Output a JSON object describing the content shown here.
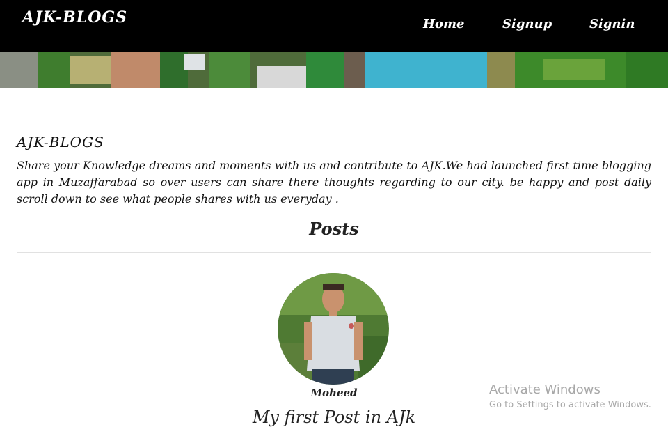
{
  "navbar": {
    "brand": "AJK-BLOGS",
    "links": [
      "Home",
      "Signup",
      "Signin"
    ]
  },
  "intro": {
    "title": "AJK-BLOGS",
    "text": "Share your Knowledge dreams and moments with us and contribute to AJK.We had launched first time blogging app in Muzaffarabad so over users can share there thoughts regarding to our city. be happy and post daily scroll down to see what people shares with us everyday ."
  },
  "posts": {
    "heading": "Posts",
    "items": [
      {
        "author": "Moheed",
        "title": "My first Post in AJk"
      }
    ]
  },
  "watermark": {
    "line1": "Activate Windows",
    "line2": "Go to Settings to activate Windows."
  },
  "colors": {
    "navbar_bg": "#000000",
    "nav_text": "#ffffff",
    "page_bg": "#ffffff"
  },
  "icons": {
    "banner": "aerial-landscape-image",
    "avatar": "user-photo"
  }
}
